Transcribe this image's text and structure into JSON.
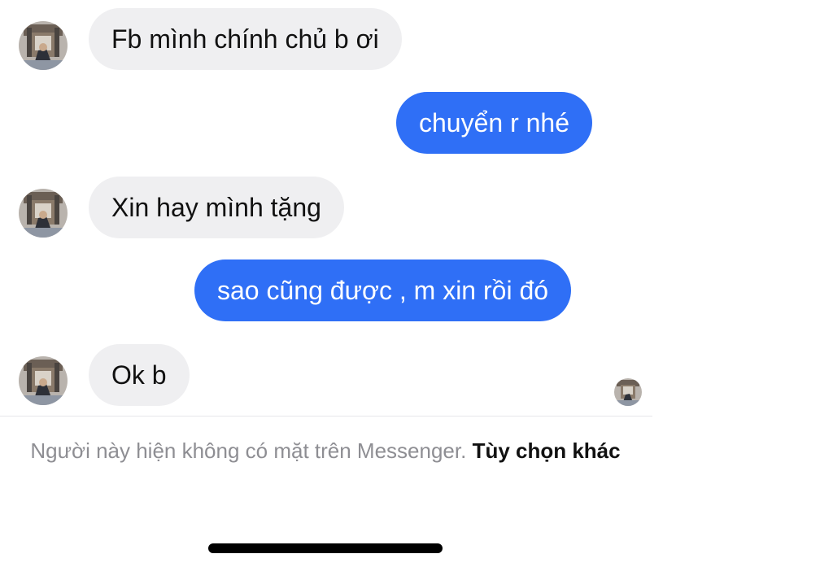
{
  "messages": [
    {
      "direction": "incoming",
      "text": "Fb mình chính chủ b ơi"
    },
    {
      "direction": "outgoing",
      "text": "chuyển r nhé"
    },
    {
      "direction": "incoming",
      "text": "Xin hay mình tặng"
    },
    {
      "direction": "outgoing",
      "text": "sao cũng được , m xin rồi đó"
    },
    {
      "direction": "incoming",
      "text": "Ok b"
    }
  ],
  "footer": {
    "notice_text": "Người này hiện không có mặt trên Messenger. ",
    "options_link": "Tùy chọn khác"
  },
  "colors": {
    "outgoing_bubble": "#2f6ff6",
    "incoming_bubble": "#efeff1",
    "notice_text": "#8e8e93"
  },
  "icons": {
    "contact_avatar": "contact-avatar-photo",
    "seen_indicator": "read-receipt-avatar"
  }
}
